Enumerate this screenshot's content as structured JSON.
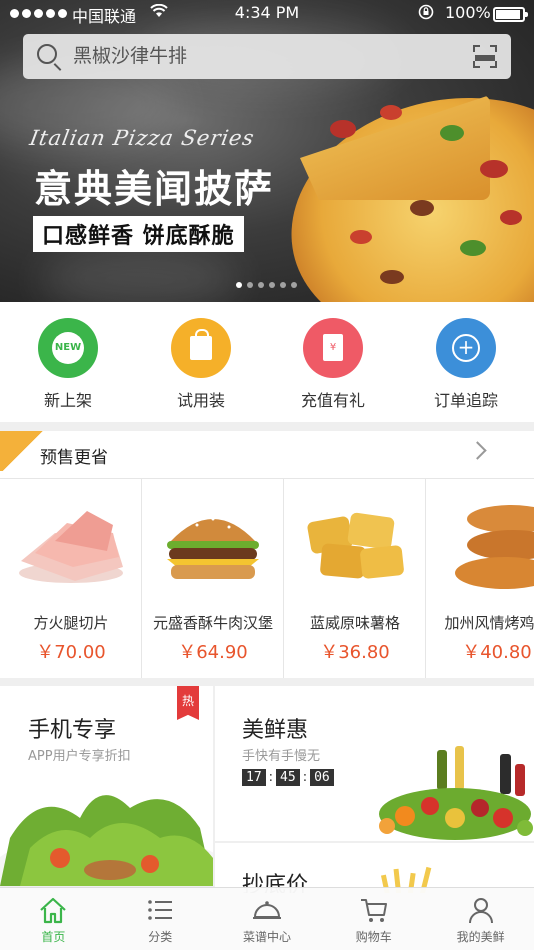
{
  "status_bar": {
    "carrier": "中国联通",
    "time": "4:34 PM",
    "battery": "100%"
  },
  "search": {
    "placeholder": "黑椒沙律牛排"
  },
  "banner": {
    "script_title": "Italian Pizza Series",
    "headline": "意典美闻披萨",
    "tagline": "口感鲜香 饼底酥脆",
    "page_count": 6,
    "active_page": 1
  },
  "quick_links": [
    {
      "label": "新上架",
      "icon": "new-badge-icon",
      "icon_text": "NEW",
      "color": "#3bb54a"
    },
    {
      "label": "试用装",
      "icon": "shopping-bag-icon",
      "color": "#f5b029"
    },
    {
      "label": "充值有礼",
      "icon": "red-envelope-icon",
      "icon_text": "¥",
      "color": "#ef5a66"
    },
    {
      "label": "订单追踪",
      "icon": "crosshair-icon",
      "color": "#3c8fd9"
    }
  ],
  "presale": {
    "title": "预售更省",
    "products": [
      {
        "name": "方火腿切片",
        "price": "￥70.00"
      },
      {
        "name": "元盛香酥牛肉汉堡",
        "price": "￥64.90"
      },
      {
        "name": "蓝威原味薯格",
        "price": "￥36.80"
      },
      {
        "name": "加州风情烤鸡翅",
        "price": "￥40.80"
      }
    ]
  },
  "promos": {
    "mobile": {
      "title": "手机专享",
      "subtitle": "APP用户专享折扣",
      "badge": "热"
    },
    "deals": {
      "title": "美鲜惠",
      "subtitle": "手快有手慢无",
      "timer": [
        "17",
        "45",
        "06"
      ]
    },
    "bottom_price": {
      "title": "抄底价"
    }
  },
  "tabbar": {
    "items": [
      {
        "label": "首页",
        "icon": "home-icon"
      },
      {
        "label": "分类",
        "icon": "list-icon"
      },
      {
        "label": "菜谱中心",
        "icon": "cloche-icon"
      },
      {
        "label": "购物车",
        "icon": "cart-icon"
      },
      {
        "label": "我的美鲜",
        "icon": "user-icon"
      }
    ],
    "active_index": 0
  },
  "colors": {
    "accent_green": "#3bb54a",
    "price_orange": "#e8552d",
    "hot_red": "#e33b3b"
  }
}
